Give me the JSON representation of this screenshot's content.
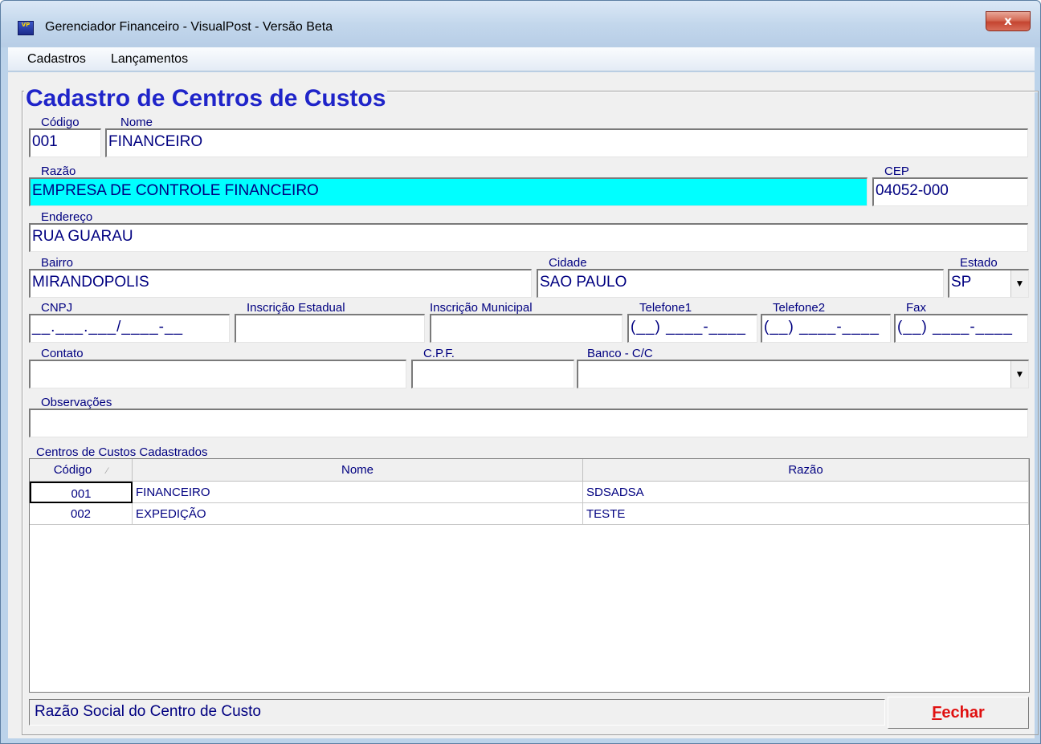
{
  "window": {
    "title": "Gerenciador Financeiro - VisualPost - Versão Beta",
    "close_label": "x"
  },
  "menu": [
    {
      "label": "Cadastros"
    },
    {
      "label": "Lançamentos"
    }
  ],
  "form": {
    "title": "Cadastro de Centros de Custos",
    "codigo": {
      "label": "Código",
      "value": "001"
    },
    "nome": {
      "label": "Nome",
      "value": "FINANCEIRO"
    },
    "razao": {
      "label": "Razão",
      "value": "EMPRESA DE CONTROLE FINANCEIRO"
    },
    "cep": {
      "label": "CEP",
      "value": "04052-000"
    },
    "endereco": {
      "label": "Endereço",
      "value": "RUA  GUARAU"
    },
    "bairro": {
      "label": "Bairro",
      "value": "MIRANDOPOLIS"
    },
    "cidade": {
      "label": "Cidade",
      "value": "SAO PAULO"
    },
    "estado": {
      "label": "Estado",
      "value": "SP"
    },
    "cnpj": {
      "label": "CNPJ",
      "mask": "__.___.___/____-__"
    },
    "inscricao_estadual": {
      "label": "Inscrição Estadual",
      "value": ""
    },
    "inscricao_municipal": {
      "label": "Inscrição Municipal",
      "value": ""
    },
    "telefone1": {
      "label": "Telefone1",
      "mask": "(__) ____-____"
    },
    "telefone2": {
      "label": "Telefone2",
      "mask": "(__) ____-____"
    },
    "fax": {
      "label": "Fax",
      "mask": "(__) ____-____"
    },
    "contato": {
      "label": "Contato",
      "value": ""
    },
    "cpf": {
      "label": "C.P.F.",
      "value": ""
    },
    "banco": {
      "label": "Banco - C/C",
      "value": ""
    },
    "observacoes": {
      "label": "Observações",
      "value": ""
    }
  },
  "grid": {
    "label": "Centros de Custos Cadastrados",
    "columns": [
      "Código",
      "Nome",
      "Razão"
    ],
    "rows": [
      {
        "codigo": "001",
        "nome": "FINANCEIRO",
        "razao": "SDSADSA"
      },
      {
        "codigo": "002",
        "nome": "EXPEDIÇÃO",
        "razao": "TESTE"
      }
    ]
  },
  "status": {
    "text": "Razão Social do Centro de Custo"
  },
  "buttons": {
    "fechar": "Fechar"
  },
  "colors": {
    "title": "#1f24c9",
    "text": "#000080",
    "highlight_field": "#00ffff",
    "fechar": "#e01010"
  }
}
